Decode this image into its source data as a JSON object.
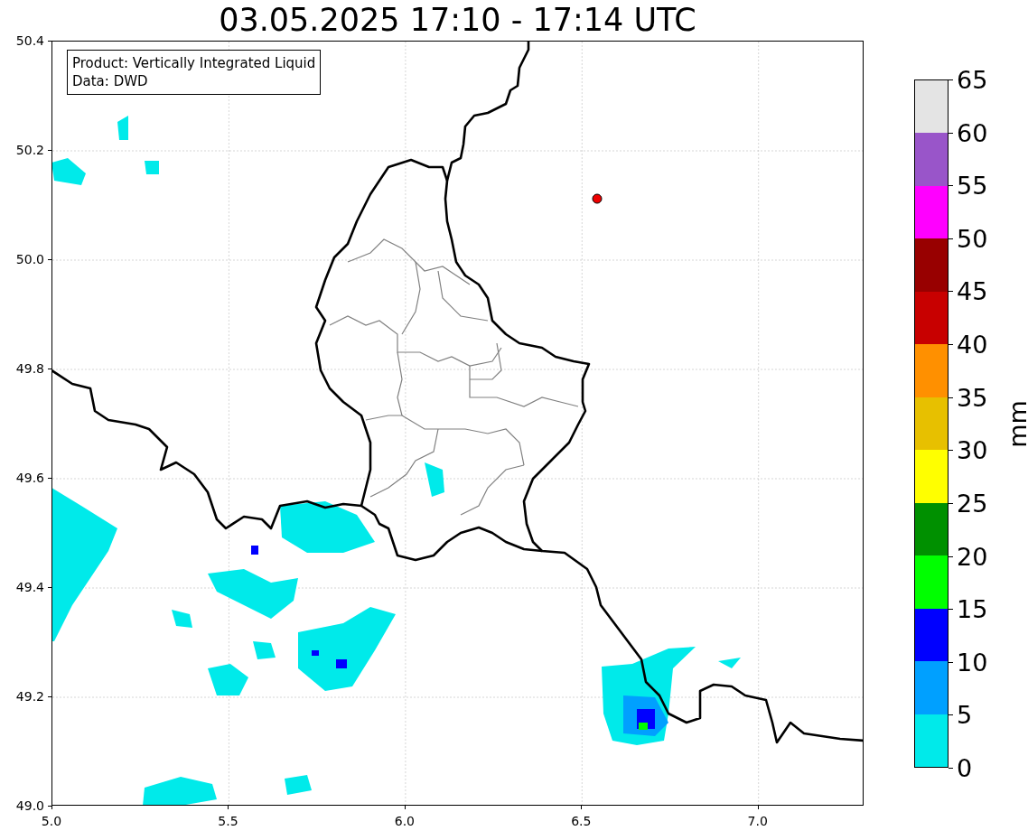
{
  "title": "03.05.2025 17:10 - 17:14 UTC",
  "legend": {
    "lines": [
      "Product: Vertically Integrated Liquid",
      "Data: DWD"
    ]
  },
  "y_ticks": [
    "50.4",
    "50.2",
    "50.0",
    "49.8",
    "49.6",
    "49.4",
    "49.2",
    "49.0"
  ],
  "x_ticks": [
    "5.0",
    "5.5",
    "6.0",
    "6.5",
    "7.0"
  ],
  "colorbar": {
    "label": "mm",
    "ticks": [
      "65",
      "60",
      "55",
      "50",
      "45",
      "40",
      "35",
      "30",
      "25",
      "20",
      "15",
      "10",
      "5",
      "0"
    ],
    "bins": [
      {
        "color": "#e4e4e4"
      },
      {
        "color": "#9955c9"
      },
      {
        "color": "#ff00ff"
      },
      {
        "color": "#980000"
      },
      {
        "color": "#c80000"
      },
      {
        "color": "#ff9000"
      },
      {
        "color": "#e7c000"
      },
      {
        "color": "#ffff00"
      },
      {
        "color": "#009000"
      },
      {
        "color": "#00ff00"
      },
      {
        "color": "#0000ff"
      },
      {
        "color": "#00a0ff"
      },
      {
        "color": "#00eaea"
      }
    ]
  }
}
